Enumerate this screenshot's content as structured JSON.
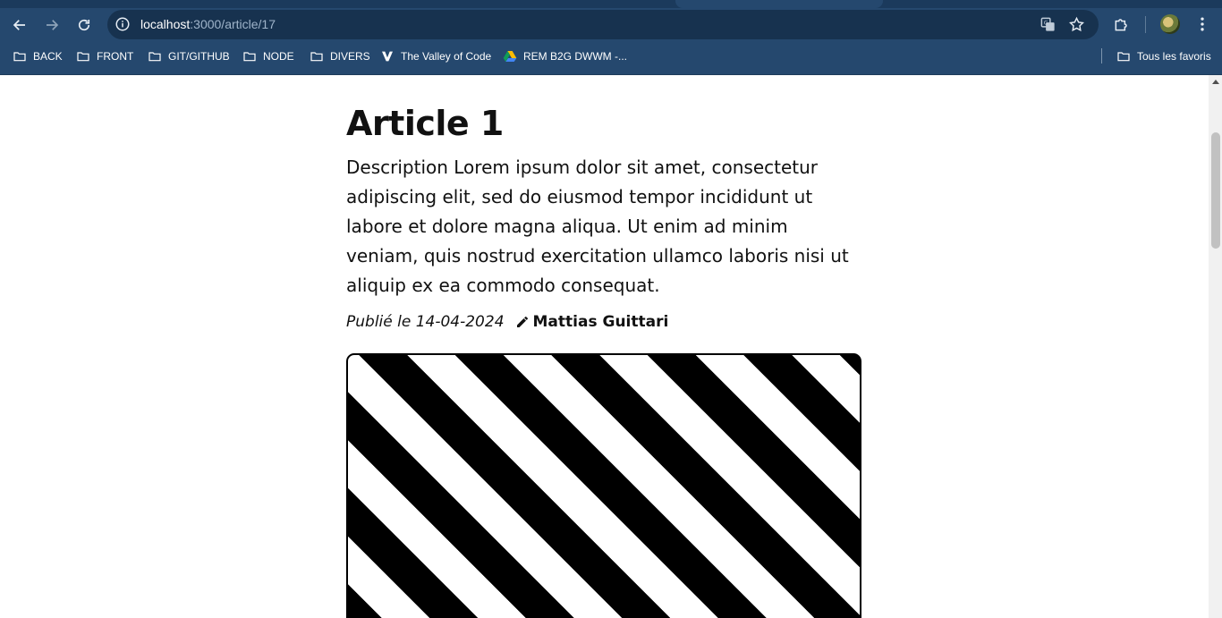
{
  "browser": {
    "url_host": "localhost",
    "url_path": ":3000/article/17",
    "bookmarks": [
      {
        "label": "BACK",
        "icon": "folder-icon"
      },
      {
        "label": "FRONT",
        "icon": "folder-icon"
      },
      {
        "label": "GIT/GITHUB",
        "icon": "folder-icon"
      },
      {
        "label": "NODE",
        "icon": "folder-icon"
      },
      {
        "label": "DIVERS",
        "icon": "folder-icon"
      },
      {
        "label": "The Valley of Code",
        "icon": "valley-logo-icon"
      },
      {
        "label": "REM B2G DWWM -...",
        "icon": "google-drive-icon"
      }
    ],
    "all_bookmarks_label": "Tous les favoris",
    "colors": {
      "chrome": "#25486e",
      "omnibox": "#17324f"
    }
  },
  "article": {
    "title": "Article 1",
    "description": "Description Lorem ipsum dolor sit amet, consectetur adipiscing elit, sed do eiusmod tempor incididunt ut labore et dolore magna aliqua. Ut enim ad minim veniam, quis nostrud exercitation ullamco laboris nisi ut aliquip ex ea commodo consequat.",
    "published": "Publié le 14-04-2024",
    "author": "Mattias Guittari"
  }
}
